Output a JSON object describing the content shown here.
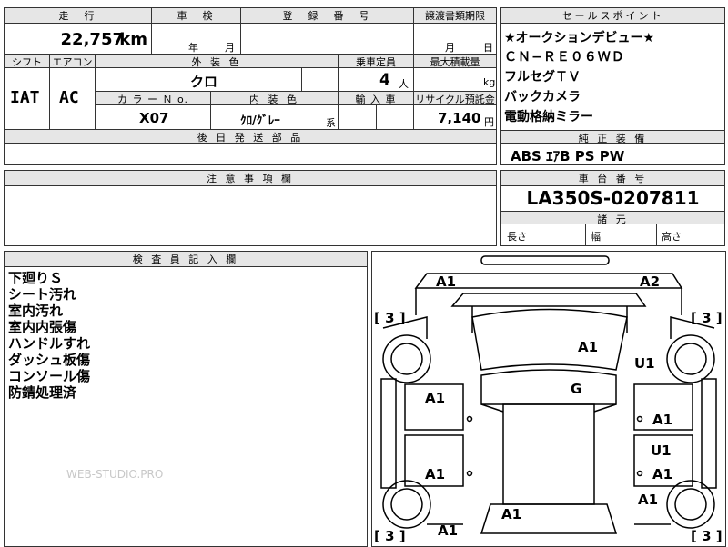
{
  "main_table": {
    "mileage_label": "走　行",
    "mileage_value": "22,757",
    "mileage_unit": "km",
    "shaken_label": "車　検",
    "shaken_year_unit": "年",
    "shaken_month_unit": "月",
    "reg_no_label": "登　録　番　号",
    "transfer_deadline_label": "譲渡書類期限",
    "transfer_month_unit": "月",
    "transfer_day_unit": "日",
    "shift_label": "シフト",
    "aircon_label": "エアコン",
    "ext_color_label": "外 装 色",
    "capacity_label": "乗車定員",
    "max_load_label": "最大積載量",
    "ext_color_value": "クロ",
    "capacity_value": "4",
    "capacity_unit": "人",
    "max_load_unit": "kg",
    "shift_value": "IAT",
    "aircon_value": "AC",
    "color_no_label": "カ ラ ー Ｎ o.",
    "int_color_label": "内 装 色",
    "import_label": "輸 入 車",
    "recycle_label": "リサイクル預託金",
    "color_no_value": "X07",
    "int_color_value": "ｸﾛ/ｸﾞﾚｰ",
    "int_color_suffix": "系",
    "recycle_value": "7,140",
    "recycle_unit": "円",
    "later_parts_label": "後 日 発 送 部 品"
  },
  "selling_points": {
    "header": "セールスポイント",
    "lines": [
      "★オークションデビュー★",
      "ＣＮ−ＲＥ０６ＷＤ",
      "フルセグＴＶ",
      "バックカメラ",
      "電動格納ミラー"
    ]
  },
  "equipment": {
    "header": "純 正 装 備",
    "value": "ABS ｴｱB PS PW"
  },
  "notes": {
    "header": "注 意 事 項 欄"
  },
  "chassis": {
    "header": "車 台 番 号",
    "value": "LA350S-0207811",
    "dims_header": "諸 元",
    "length_label": "長さ",
    "width_label": "幅",
    "height_label": "高さ"
  },
  "inspector": {
    "header": "検 査 員 記 入 欄",
    "lines": [
      "下廻りＳ",
      "シート汚れ",
      "室内汚れ",
      "室内内張傷",
      "ハンドルすれ",
      "ダッシュ板傷",
      "コンソール傷",
      "防錆処理済"
    ]
  },
  "watermark": "WEB-STUDIO.PRO",
  "diagram": {
    "tire_left_top": "[ 3 ]",
    "tire_right_top": "[ 3 ]",
    "tire_left_bottom": "[ 3 ]",
    "tire_right_bottom": "[ 3 ]",
    "marks": {
      "front_left": "A1",
      "front_right": "A2",
      "hood": "A1",
      "right_fender": "U1",
      "roof": "G",
      "left_front_door": "A1",
      "right_front_door": "A1",
      "right_rear_door_u": "U1",
      "left_rear_door": "A1",
      "right_rear_door": "A1",
      "right_quarter": "A1",
      "tailgate": "A1",
      "rear_left": "A1"
    }
  }
}
